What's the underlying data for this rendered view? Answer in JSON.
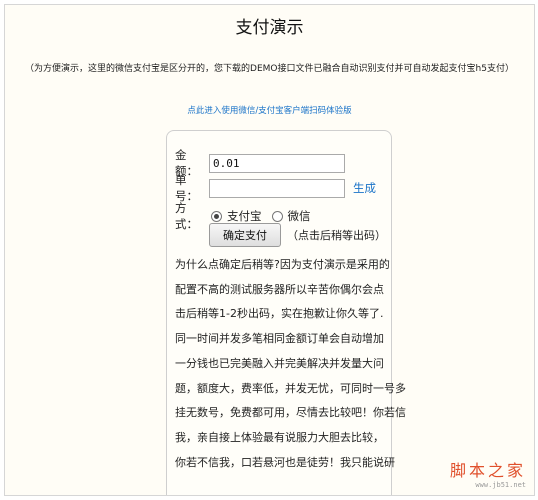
{
  "page": {
    "title": "支付演示",
    "note": "（为方便演示，这里的微信支付宝是区分开的，您下载的DEMO接口文件已融合自动识别支付并可自动发起支付宝h5支付）",
    "client_link": "点此进入使用微信/支付宝客户端扫码体验版"
  },
  "form": {
    "amount_label": "金额：",
    "amount_value": "0.01",
    "order_label": "单号：",
    "order_value": "",
    "generate_label": "生成",
    "method_label": "方式：",
    "methods": [
      {
        "label": "支付宝",
        "selected": true
      },
      {
        "label": "微信",
        "selected": false
      }
    ],
    "submit_label": "确定支付",
    "submit_hint": "（点击后稍等出码）"
  },
  "explanation": [
    "为什么点确定后稍等?因为支付演示是采用的",
    "配置不高的测试服务器所以辛苦你偶尔会点",
    "击后稍等1-2秒出码，实在抱歉让你久等了.",
    "同一时间并发多笔相同金额订单会自动增加",
    "一分钱也已完美融入并完美解决并发量大问",
    "题，额度大，费率低，并发无忧，可同时一号多",
    "挂无数号，免费都可用，尽情去比较吧！你若信",
    "我，亲自接上体验最有说服力大胆去比较，",
    "你若不信我，口若悬河也是徒劳！我只能说研"
  ],
  "watermark": {
    "main": "脚本之家",
    "sub": "www.jb51.net"
  }
}
